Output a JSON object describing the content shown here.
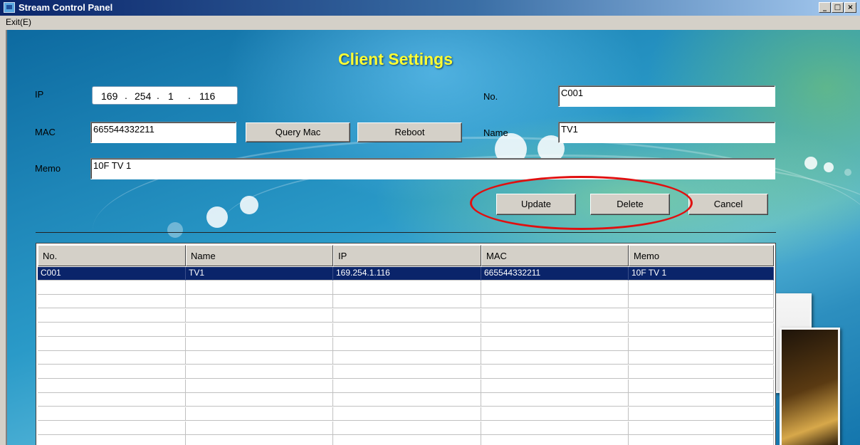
{
  "window": {
    "title": "Stream Control Panel",
    "controls": {
      "minimize": "_",
      "maximize": "□",
      "close": "×"
    }
  },
  "menu": {
    "exit": "Exit(E)"
  },
  "form": {
    "heading": "Client Settings",
    "ip": {
      "label": "IP",
      "octets": [
        "169",
        "254",
        "1",
        "116"
      ]
    },
    "mac": {
      "label": "MAC",
      "value": "665544332211"
    },
    "memo": {
      "label": "Memo",
      "value": "10F TV 1"
    },
    "no": {
      "label": "No.",
      "value": "C001"
    },
    "name": {
      "label": "Name",
      "value": "TV1"
    },
    "buttons": {
      "query_mac": "Query Mac",
      "reboot": "Reboot",
      "update": "Update",
      "delete": "Delete",
      "cancel": "Cancel"
    }
  },
  "table": {
    "columns": [
      "No.",
      "Name",
      "IP",
      "MAC",
      "Memo"
    ],
    "rows": [
      [
        "C001",
        "TV1",
        "169.254.1.116",
        "665544332211",
        "10F TV 1"
      ]
    ],
    "selected_row": 0
  },
  "colors": {
    "heading": "#ffff33",
    "selection": "#0a246a",
    "highlight_oval": "#e01010"
  }
}
